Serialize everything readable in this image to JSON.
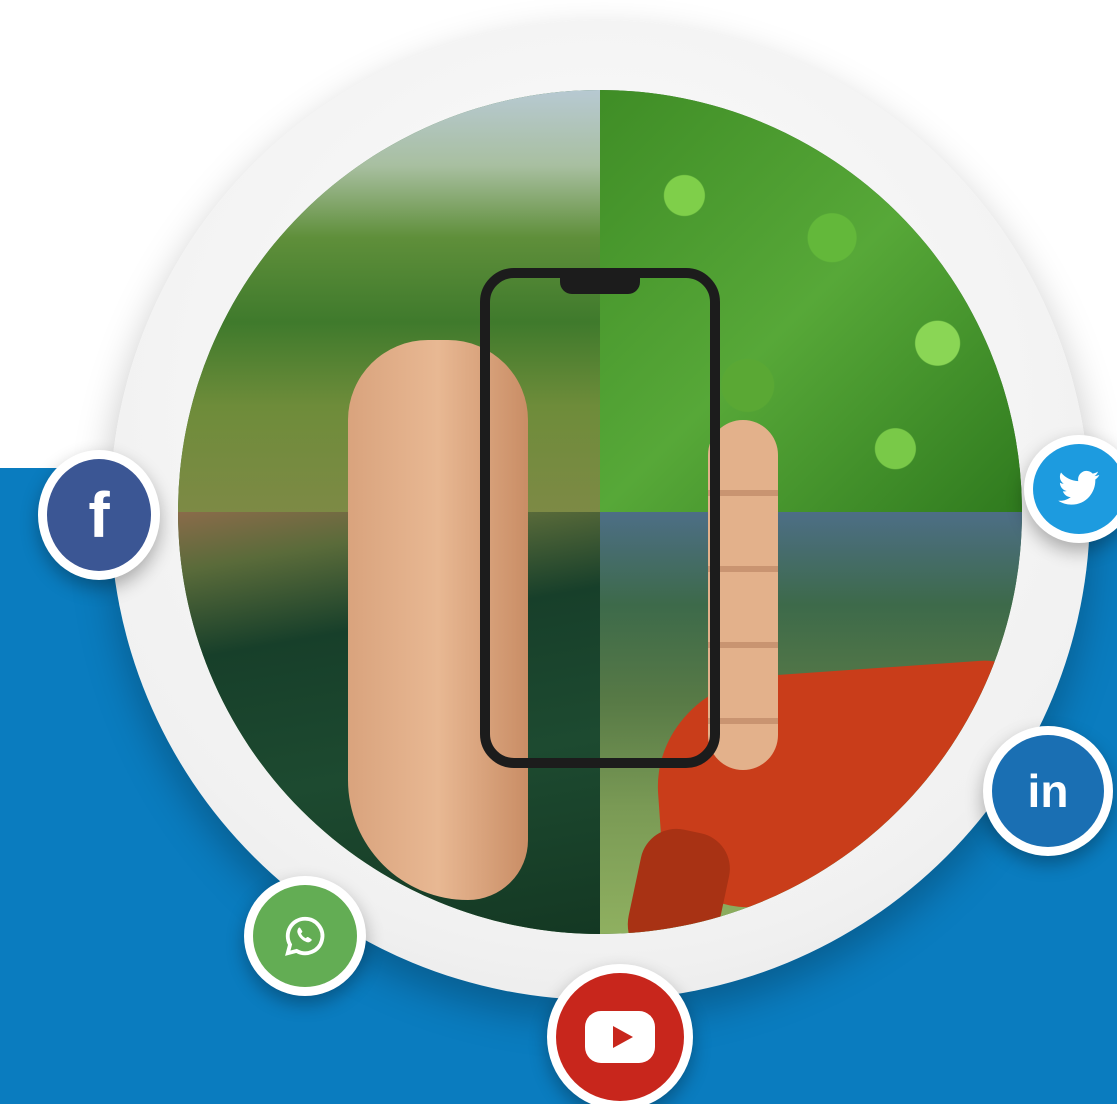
{
  "social": {
    "facebook": {
      "glyph": "f",
      "icon": "facebook-icon",
      "color": "#3b5694"
    },
    "twitter": {
      "icon": "twitter-icon",
      "color": "#1d9bdf"
    },
    "linkedin": {
      "glyph": "in",
      "icon": "linkedin-icon",
      "color": "#1a6fb3"
    },
    "whatsapp": {
      "icon": "whatsapp-icon",
      "color": "#63ad54"
    },
    "youtube": {
      "icon": "youtube-icon",
      "color": "#c8261c"
    }
  },
  "colors": {
    "background_band": "#0a7cbf",
    "ring": "#f1f1f1"
  }
}
